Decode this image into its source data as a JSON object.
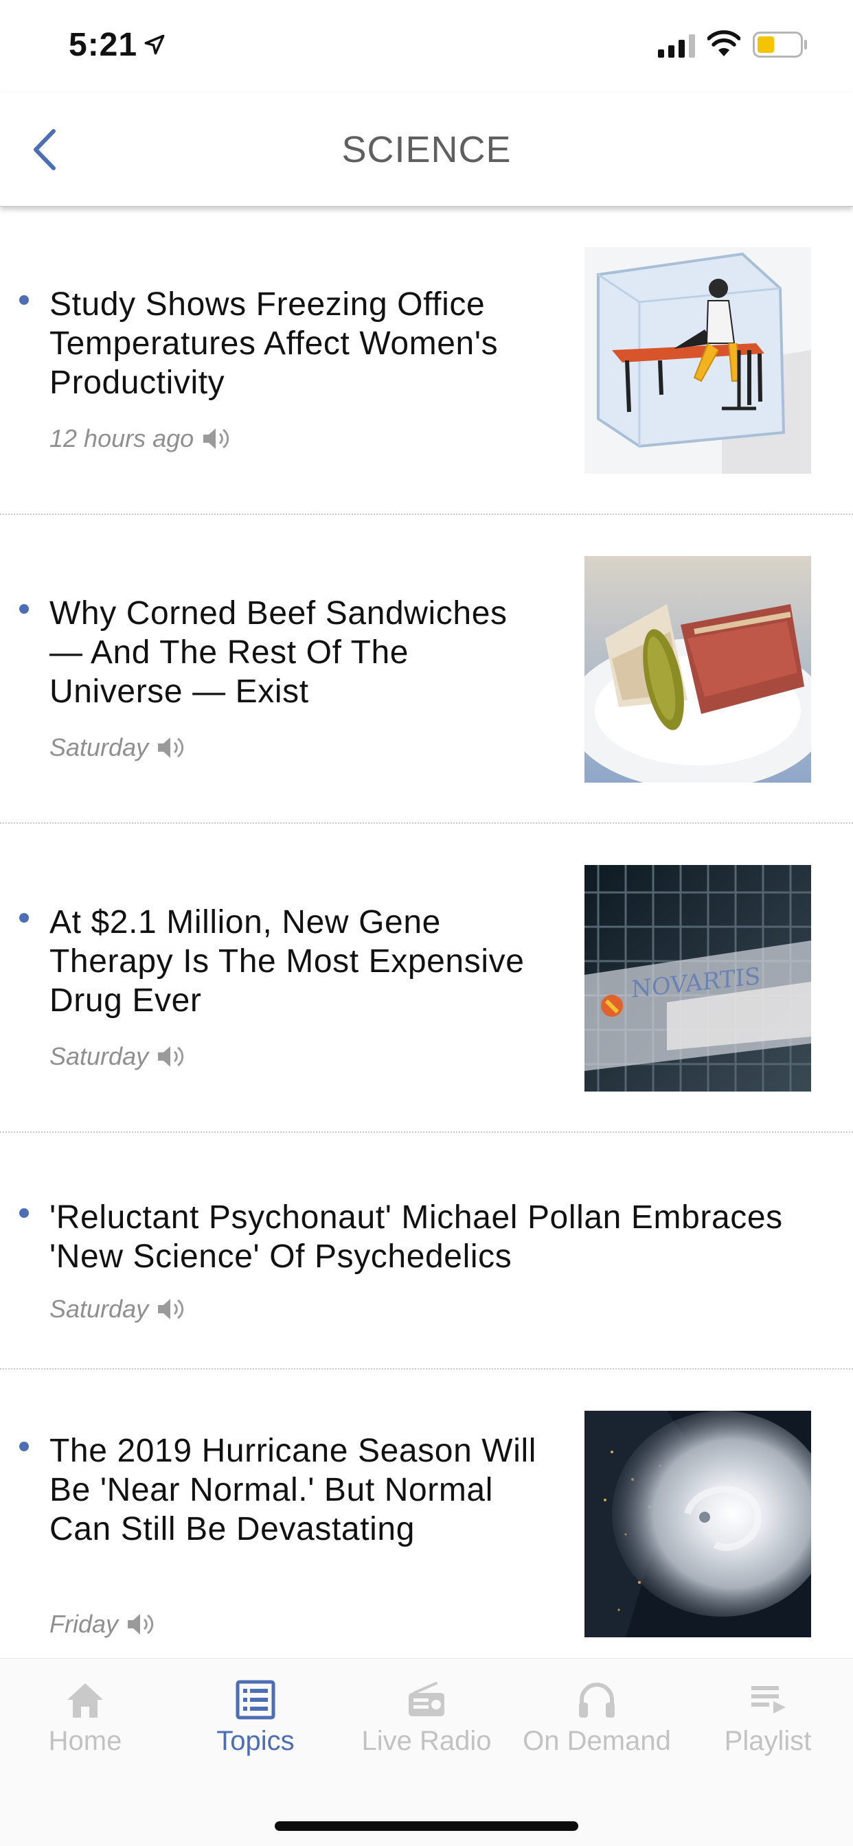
{
  "status_bar": {
    "time": "5:21",
    "battery_color": "#f5c400"
  },
  "nav": {
    "title": "SCIENCE",
    "back_icon": "chevron-left-icon",
    "accent_color": "#4d6eb5"
  },
  "articles": [
    {
      "headline": "Study Shows Freezing Office Temperatures Affect Women's Productivity",
      "time": "12 hours ago",
      "thumbnail": "woman-at-desk-in-ice-cube-image"
    },
    {
      "headline": "Why Corned Beef Sandwiches — And The Rest Of The Universe — Exist",
      "time": "Saturday",
      "thumbnail": "corned-beef-sandwich-image"
    },
    {
      "headline": "At $2.1 Million, New Gene Therapy Is The Most Expensive Drug Ever",
      "time": "Saturday",
      "thumbnail": "novartis-building-image",
      "thumbnail_text": "NOVARTIS"
    },
    {
      "headline": "'Reluctant Psychonaut' Michael Pollan Embraces 'New Science' Of Psychedelics",
      "time": "Saturday"
    },
    {
      "headline": "The 2019 Hurricane Season Will Be 'Near Normal.' But Normal Can Still Be Devastating",
      "time": "Friday",
      "thumbnail": "hurricane-satellite-image"
    }
  ],
  "tabs": [
    {
      "label": "Home",
      "icon": "home-icon",
      "active": false
    },
    {
      "label": "Topics",
      "icon": "topics-icon",
      "active": true
    },
    {
      "label": "Live Radio",
      "icon": "radio-icon",
      "active": false
    },
    {
      "label": "On Demand",
      "icon": "headphones-icon",
      "active": false
    },
    {
      "label": "Playlist",
      "icon": "playlist-icon",
      "active": false
    }
  ]
}
